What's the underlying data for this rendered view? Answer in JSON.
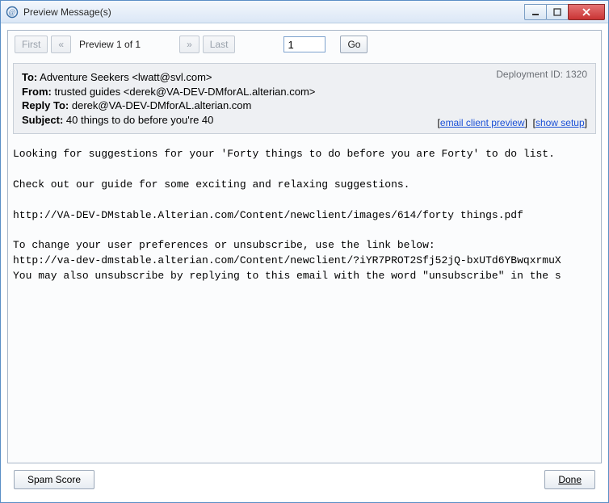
{
  "window": {
    "title": "Preview Message(s)"
  },
  "nav": {
    "first": "First",
    "prev": "«",
    "label": "Preview 1 of 1",
    "next": "»",
    "last": "Last",
    "page_value": "1",
    "go": "Go"
  },
  "header": {
    "deployment_label": "Deployment ID: 1320",
    "to_label": "To:",
    "to_value": "Adventure Seekers <lwatt@svl.com>",
    "from_label": "From:",
    "from_value": "trusted guides <derek@VA-DEV-DMforAL.alterian.com>",
    "reply_label": "Reply To:",
    "reply_value": "derek@VA-DEV-DMforAL.alterian.com",
    "subject_label": "Subject:",
    "subject_value": "40 things to do before you're 40",
    "link_email_client": "email client preview",
    "link_show_setup": "show setup"
  },
  "body": {
    "text": "Looking for suggestions for your 'Forty things to do before you are Forty' to do list.\n\nCheck out our guide for some exciting and relaxing suggestions.\n\nhttp://VA-DEV-DMstable.Alterian.com/Content/newclient/images/614/forty things.pdf\n\nTo change your user preferences or unsubscribe, use the link below:\nhttp://va-dev-dmstable.alterian.com/Content/newclient/?iYR7PROT2Sfj52jQ-bxUTd6YBwqxrmuX\nYou may also unsubscribe by replying to this email with the word \"unsubscribe\" in the s"
  },
  "footer": {
    "spam_score": "Spam Score",
    "done": "Done"
  }
}
